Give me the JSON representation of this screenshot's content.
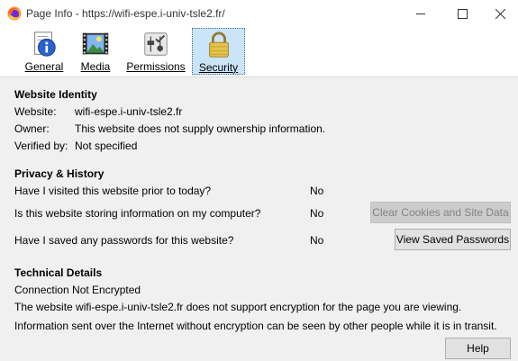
{
  "window": {
    "title": "Page Info - https://wifi-espe.i-univ-tsle2.fr/"
  },
  "tabs": [
    {
      "label": "General",
      "icon": "info-icon",
      "selected": false
    },
    {
      "label": "Media",
      "icon": "media-icon",
      "selected": false
    },
    {
      "label": "Permissions",
      "icon": "permissions-icon",
      "selected": false
    },
    {
      "label": "Security",
      "icon": "padlock-icon",
      "selected": true
    }
  ],
  "identity": {
    "heading": "Website Identity",
    "website_label": "Website:",
    "website_value": "wifi-espe.i-univ-tsle2.fr",
    "owner_label": "Owner:",
    "owner_value": "This website does not supply ownership information.",
    "verified_label": "Verified by:",
    "verified_value": "Not specified"
  },
  "privacy": {
    "heading": "Privacy & History",
    "q1": "Have I visited this website prior to today?",
    "a1": "No",
    "q2": "Is this website storing information on my computer?",
    "a2": "No",
    "q3": "Have I saved any passwords for this website?",
    "a3": "No",
    "clear_button": "Clear Cookies and Site Data",
    "view_passwords_button": "View Saved Passwords"
  },
  "technical": {
    "heading": "Technical Details",
    "line1": "Connection Not Encrypted",
    "line2": "The website wifi-espe.i-univ-tsle2.fr does not support encryption for the page you are viewing.",
    "line3": "Information sent over the Internet without encryption can be seen by other people while it is in transit."
  },
  "footer": {
    "help_button": "Help"
  },
  "colors": {
    "selected_tab_bg": "#cce4f7",
    "window_bg": "#f0f0f0"
  }
}
